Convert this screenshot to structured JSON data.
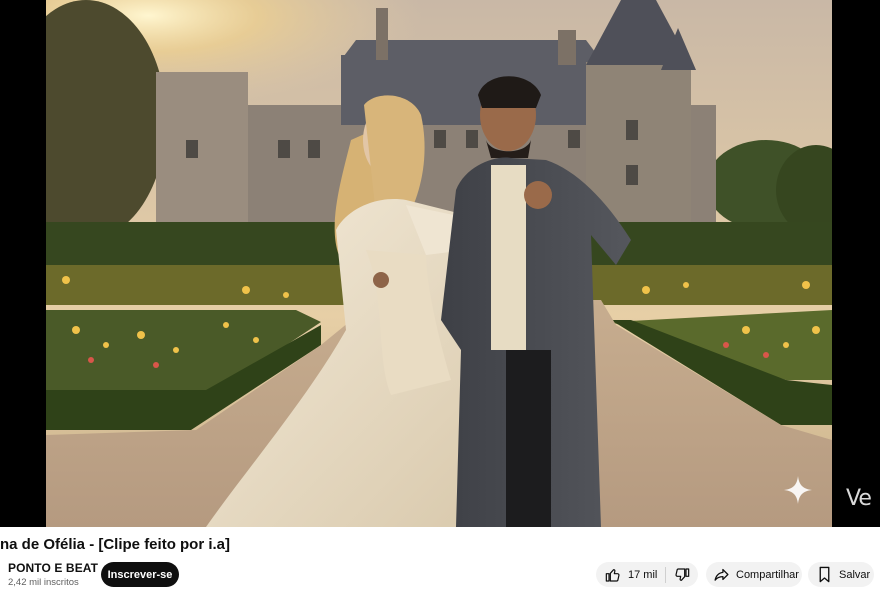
{
  "video": {
    "title": "na de Ofélia - [Clipe feito por i.a]",
    "watermark": "Ve"
  },
  "channel": {
    "name": "PONTO E BEAT",
    "subscribers": "2,42 mil inscritos",
    "subscribe_label": "Inscrever-se"
  },
  "actions": {
    "like_count": "17 mil",
    "share_label": "Compartilhar",
    "save_label": "Salvar"
  },
  "icons": {
    "like": "thumbs-up-icon",
    "dislike": "thumbs-down-icon",
    "share": "share-arrow-icon",
    "save": "bookmark-icon",
    "sparkle": "sparkle-icon"
  }
}
